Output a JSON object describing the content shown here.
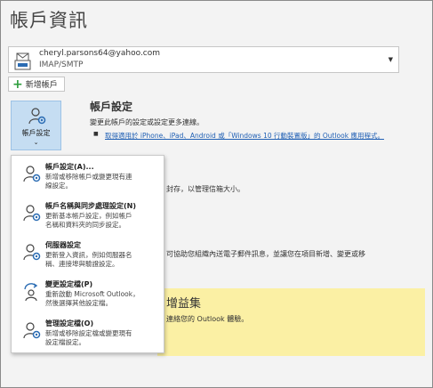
{
  "page": {
    "title": "帳戶資訊"
  },
  "account_selector": {
    "email": "cheryl.parsons64@yahoo.com",
    "type": "IMAP/SMTP"
  },
  "add_account": {
    "label": "新增帳戶"
  },
  "account_settings_tile": {
    "label": "帳戶設定"
  },
  "account_settings_section": {
    "title": "帳戶設定",
    "description": "變更此帳戶的設定或設定更多連線。",
    "mobile_link": "取得適用於 iPhone、iPad、Android 或「Windows 10 行動裝置版」的 Outlook 應用程式。"
  },
  "background_text": {
    "mailbox_fragment": "封存，以管理信箱大小。",
    "rules_fragment": "可協助您組織內送電子郵件訊息，並讓您在項目新增、變更或移"
  },
  "addins_band": {
    "title_fragment": "增益集",
    "description_fragment": "連絡您的 Outlook 體驗。"
  },
  "dropdown_menu": {
    "items": [
      {
        "title": "帳戶設定(A)...",
        "description": "新增或移除帳戶或變更現有連\n線設定。"
      },
      {
        "title": "帳戶名稱與同步處理設定(N)",
        "description": "更新基本帳戶設定，例如帳戶\n名稱和資料夾的同步設定。"
      },
      {
        "title": "伺服器設定",
        "description": "更新登入資訊，例如伺服器名\n稱、連接埠與驗證設定。"
      },
      {
        "title": "變更設定檔(P)",
        "description": "重新啟動 Microsoft Outlook，\n然後選擇其他設定檔。"
      },
      {
        "title": "管理設定檔(O)",
        "description": "新增或移除設定檔或變更現有\n設定檔設定。"
      }
    ]
  },
  "colors": {
    "tile_bg": "#c5ddf2",
    "link": "#1f5fb4",
    "addins_band": "#fbf0a4",
    "add_icon": "#2e9e3e"
  },
  "icons": [
    "account-icon",
    "account-settings-icon",
    "account-gear-icon",
    "sync-icon",
    "server-icon",
    "switch-profile-icon",
    "manage-profile-icon",
    "plus-icon",
    "chevron-down-icon"
  ]
}
